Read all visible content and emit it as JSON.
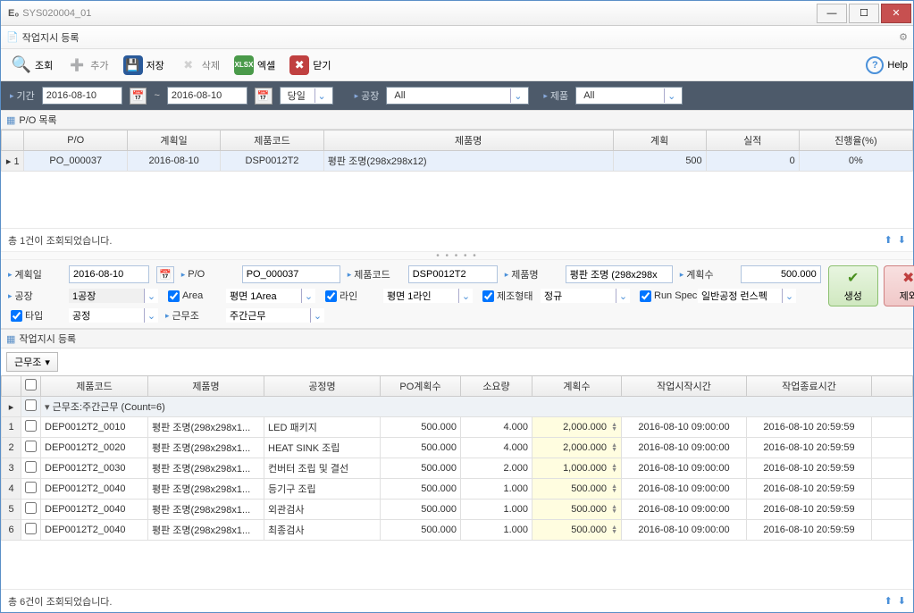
{
  "window": {
    "title": "SYS020004_01"
  },
  "page": {
    "title": "작업지시 등록"
  },
  "toolbar": {
    "search": "조회",
    "add": "추가",
    "save": "저장",
    "delete": "삭제",
    "excel": "엑셀",
    "close": "닫기",
    "help": "Help"
  },
  "filter": {
    "period_label": "기간",
    "date_from": "2016-08-10",
    "date_to": "2016-08-10",
    "period_type": "당일",
    "factory_label": "공장",
    "factory_value": "All",
    "product_label": "제품",
    "product_value": "All"
  },
  "po_section": {
    "title": "P/O 목록",
    "columns": {
      "po": "P/O",
      "plan_date": "계획일",
      "prod_code": "제품코드",
      "prod_name": "제품명",
      "plan": "계획",
      "actual": "실적",
      "progress": "진행율(%)"
    },
    "rows": [
      {
        "idx": "1",
        "po": "PO_000037",
        "plan_date": "2016-08-10",
        "prod_code": "DSP0012T2",
        "prod_name": "평판 조명(298x298x12)",
        "plan": "500",
        "actual": "0",
        "progress": "0%"
      }
    ],
    "status": "총 1건이 조회되었습니다."
  },
  "form": {
    "plan_date_label": "계획일",
    "plan_date": "2016-08-10",
    "po_label": "P/O",
    "po": "PO_000037",
    "prodcode_label": "제품코드",
    "prodcode": "DSP0012T2",
    "prodname_label": "제품명",
    "prodname": "평판 조명 (298x298x",
    "planqty_label": "계획수",
    "planqty": "500.000",
    "factory_label": "공장",
    "factory": "1공장",
    "area_label": "Area",
    "area": "평면 1Area",
    "line_label": "라인",
    "line": "평면 1라인",
    "mfgtype_label": "제조형태",
    "mfgtype": "정규",
    "runspec_label": "Run Spec",
    "runspec": "일반공정 런스펙",
    "type_label": "타입",
    "type": "공정",
    "shift_label": "근무조",
    "shift": "주간근무",
    "btn_gen": "생성",
    "btn_excl": "제외"
  },
  "wo_section": {
    "title": "작업지시 등록",
    "group_btn": "근무조",
    "columns": {
      "prodcode": "제품코드",
      "prodname": "제품명",
      "proc": "공정명",
      "poqty": "PO계획수",
      "usage": "소요량",
      "planqty": "계획수",
      "start": "작업시작시간",
      "end": "작업종료시간"
    },
    "group_row": "근무조:주간근무 (Count=6)",
    "rows": [
      {
        "idx": "1",
        "code": "DEP0012T2_0010",
        "name": "평판 조명(298x298x1...",
        "proc": "LED 패키지",
        "poqty": "500.000",
        "usage": "4.000",
        "planqty": "2,000.000",
        "start": "2016-08-10 09:00:00",
        "end": "2016-08-10 20:59:59"
      },
      {
        "idx": "2",
        "code": "DEP0012T2_0020",
        "name": "평판 조명(298x298x1...",
        "proc": "HEAT SINK 조립",
        "poqty": "500.000",
        "usage": "4.000",
        "planqty": "2,000.000",
        "start": "2016-08-10 09:00:00",
        "end": "2016-08-10 20:59:59"
      },
      {
        "idx": "3",
        "code": "DEP0012T2_0030",
        "name": "평판 조명(298x298x1...",
        "proc": "컨버터 조립 및 결선",
        "poqty": "500.000",
        "usage": "2.000",
        "planqty": "1,000.000",
        "start": "2016-08-10 09:00:00",
        "end": "2016-08-10 20:59:59"
      },
      {
        "idx": "4",
        "code": "DEP0012T2_0040",
        "name": "평판 조명(298x298x1...",
        "proc": "등기구 조립",
        "poqty": "500.000",
        "usage": "1.000",
        "planqty": "500.000",
        "start": "2016-08-10 09:00:00",
        "end": "2016-08-10 20:59:59"
      },
      {
        "idx": "5",
        "code": "DEP0012T2_0040",
        "name": "평판 조명(298x298x1...",
        "proc": "외관검사",
        "poqty": "500.000",
        "usage": "1.000",
        "planqty": "500.000",
        "start": "2016-08-10 09:00:00",
        "end": "2016-08-10 20:59:59"
      },
      {
        "idx": "6",
        "code": "DEP0012T2_0040",
        "name": "평판 조명(298x298x1...",
        "proc": "최종검사",
        "poqty": "500.000",
        "usage": "1.000",
        "planqty": "500.000",
        "start": "2016-08-10 09:00:00",
        "end": "2016-08-10 20:59:59"
      }
    ],
    "status": "총 6건이 조회되었습니다."
  }
}
